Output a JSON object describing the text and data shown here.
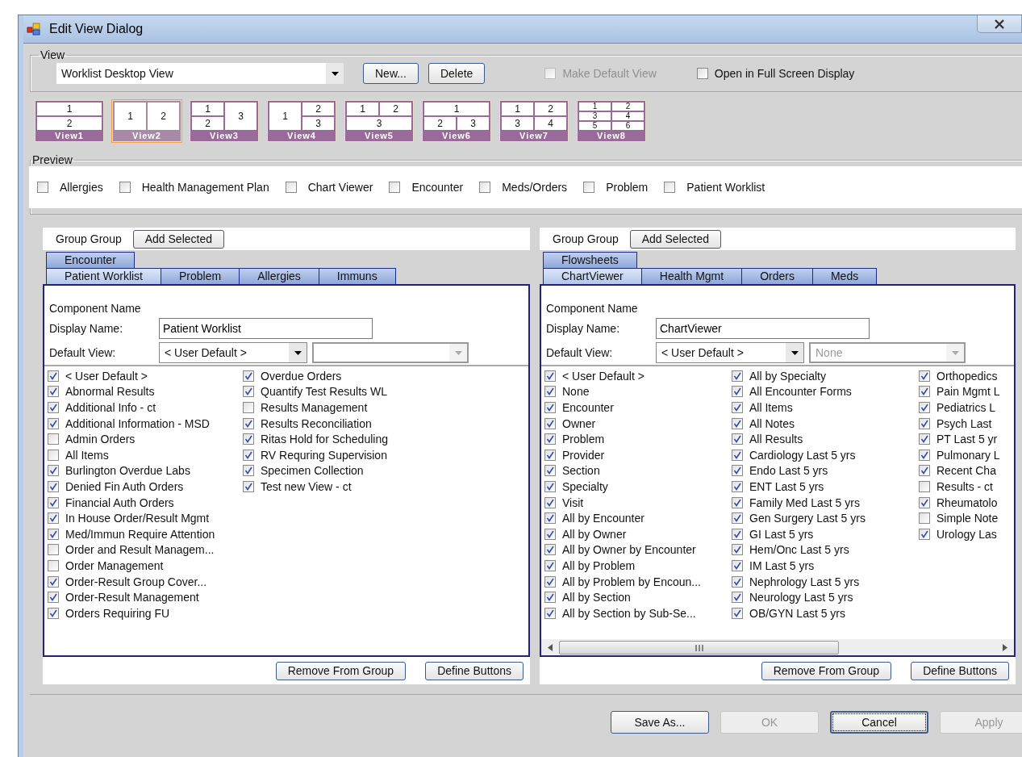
{
  "window": {
    "title": "Edit View Dialog"
  },
  "view_group": {
    "label": "View",
    "dropdown": {
      "value": "Worklist Desktop View"
    },
    "buttons": [
      "New...",
      "Delete"
    ],
    "checkboxes": [
      {
        "label": "Make Default View",
        "checked": false,
        "disabled": true
      },
      {
        "label": "Open in Full Screen Display",
        "checked": false,
        "disabled": false
      }
    ]
  },
  "layouts": [
    {
      "label": "View1",
      "kind": "stack2",
      "cells": [
        "1",
        "2"
      ],
      "selected": false
    },
    {
      "label": "View2",
      "kind": "side2",
      "cells": [
        "1",
        "2"
      ],
      "selected": true
    },
    {
      "label": "View3",
      "kind": "left-split",
      "cells": [
        "1",
        "2",
        "3"
      ],
      "selected": false
    },
    {
      "label": "View4",
      "kind": "right-split",
      "cells": [
        "1",
        "2",
        "3"
      ],
      "selected": false
    },
    {
      "label": "View5",
      "kind": "top-split",
      "cells": [
        "1",
        "2",
        "3"
      ],
      "selected": false
    },
    {
      "label": "View6",
      "kind": "bottom-split",
      "cells": [
        "1",
        "2",
        "3"
      ],
      "selected": false
    },
    {
      "label": "View7",
      "kind": "grid4",
      "cells": [
        "1",
        "2",
        "3",
        "4"
      ],
      "selected": false
    },
    {
      "label": "View8",
      "kind": "grid6",
      "cells": [
        "1",
        "2",
        "3",
        "4",
        "5",
        "6"
      ],
      "selected": false
    }
  ],
  "preview": {
    "label": "Preview",
    "items": [
      {
        "label": "Allergies",
        "checked": false
      },
      {
        "label": "Health Management Plan",
        "checked": false
      },
      {
        "label": "Chart Viewer",
        "checked": false
      },
      {
        "label": "Encounter",
        "checked": false
      },
      {
        "label": "Meds/Orders",
        "checked": false
      },
      {
        "label": "Problem",
        "checked": false
      },
      {
        "label": "Patient Worklist",
        "checked": false
      }
    ]
  },
  "panels": [
    {
      "group_label": "Group Group",
      "add_button": "Add Selected",
      "tab_rows": [
        [
          {
            "label": "Encounter",
            "selected": false
          }
        ],
        [
          {
            "label": "Patient Worklist",
            "selected": true
          },
          {
            "label": "Problem",
            "selected": false
          },
          {
            "label": "Allergies",
            "selected": false
          },
          {
            "label": "Immuns",
            "selected": false
          }
        ]
      ],
      "component_label": "Component Name",
      "display_label": "Display Name:",
      "display_value": "Patient Worklist",
      "default_label": "Default View:",
      "default_value": "< User Default >",
      "secondary": {
        "disabled": true
      },
      "columns": [
        [
          {
            "label": "< User Default >",
            "checked": true
          },
          {
            "label": "Abnormal Results",
            "checked": true
          },
          {
            "label": "Additional Info - ct",
            "checked": true
          },
          {
            "label": "Additional Information - MSD",
            "checked": true
          },
          {
            "label": "Admin Orders",
            "checked": false
          },
          {
            "label": "All Items",
            "checked": false
          },
          {
            "label": "Burlington Overdue Labs",
            "checked": true
          },
          {
            "label": "Denied Fin Auth Orders",
            "checked": true
          },
          {
            "label": "Financial Auth Orders",
            "checked": true
          },
          {
            "label": "In House Order/Result Mgmt",
            "checked": true
          },
          {
            "label": "Med/Immun Require Attention",
            "checked": true
          },
          {
            "label": "Order and Result Managem...",
            "checked": false
          },
          {
            "label": "Order Management",
            "checked": false
          },
          {
            "label": "Order-Result Group Cover...",
            "checked": true
          },
          {
            "label": "Order-Result Management",
            "checked": true
          },
          {
            "label": "Orders Requiring FU",
            "checked": true
          }
        ],
        [
          {
            "label": "Overdue Orders",
            "checked": true
          },
          {
            "label": "Quantify Test Results WL",
            "checked": true
          },
          {
            "label": "Results Management",
            "checked": false
          },
          {
            "label": "Results Reconciliation",
            "checked": true
          },
          {
            "label": "Ritas Hold for Scheduling",
            "checked": true
          },
          {
            "label": "RV Requring Supervision",
            "checked": true
          },
          {
            "label": "Specimen Collection",
            "checked": true
          },
          {
            "label": "Test new View - ct",
            "checked": true
          }
        ]
      ],
      "buttons": [
        "Remove From Group",
        "Define Buttons"
      ]
    },
    {
      "group_label": "Group Group",
      "add_button": "Add Selected",
      "tab_rows": [
        [
          {
            "label": "Flowsheets",
            "selected": false
          }
        ],
        [
          {
            "label": "ChartViewer",
            "selected": true
          },
          {
            "label": "Health Mgmt",
            "selected": false
          },
          {
            "label": "Orders",
            "selected": false
          },
          {
            "label": "Meds",
            "selected": false
          }
        ]
      ],
      "component_label": "Component Name",
      "display_label": "Display Name:",
      "display_value": "ChartViewer",
      "default_label": "Default View:",
      "default_value": "< User Default >",
      "secondary": {
        "value": "None",
        "disabled": true
      },
      "columns": [
        [
          {
            "label": "< User Default >",
            "checked": true
          },
          {
            "label": "None",
            "checked": true
          },
          {
            "label": "Encounter",
            "checked": true
          },
          {
            "label": "Owner",
            "checked": true
          },
          {
            "label": "Problem",
            "checked": true
          },
          {
            "label": "Provider",
            "checked": true
          },
          {
            "label": "Section",
            "checked": true
          },
          {
            "label": "Specialty",
            "checked": true
          },
          {
            "label": "Visit",
            "checked": true
          },
          {
            "label": "All by Encounter",
            "checked": true
          },
          {
            "label": "All by Owner",
            "checked": true
          },
          {
            "label": "All by Owner by Encounter",
            "checked": true
          },
          {
            "label": "All by Problem",
            "checked": true
          },
          {
            "label": "All by Problem by Encoun...",
            "checked": true
          },
          {
            "label": "All by Section",
            "checked": true
          },
          {
            "label": "All by Section by Sub-Se...",
            "checked": true
          }
        ],
        [
          {
            "label": "All by Specialty",
            "checked": true
          },
          {
            "label": "All Encounter Forms",
            "checked": true
          },
          {
            "label": "All Items",
            "checked": true
          },
          {
            "label": "All Notes",
            "checked": true
          },
          {
            "label": "All Results",
            "checked": true
          },
          {
            "label": "Cardiology Last 5 yrs",
            "checked": true
          },
          {
            "label": "Endo Last 5 yrs",
            "checked": true
          },
          {
            "label": "ENT Last 5 yrs",
            "checked": true
          },
          {
            "label": "Family Med Last 5 yrs",
            "checked": true
          },
          {
            "label": "Gen Surgery Last 5 yrs",
            "checked": true
          },
          {
            "label": "GI Last 5 yrs",
            "checked": true
          },
          {
            "label": "Hem/Onc Last 5 yrs",
            "checked": true
          },
          {
            "label": "IM Last 5 yrs",
            "checked": true
          },
          {
            "label": "Nephrology Last 5 yrs",
            "checked": true
          },
          {
            "label": "Neurology Last 5 yrs",
            "checked": true
          },
          {
            "label": "OB/GYN Last 5 yrs",
            "checked": true
          }
        ],
        [
          {
            "label": "Orthopedics",
            "checked": true
          },
          {
            "label": "Pain Mgmt L",
            "checked": true
          },
          {
            "label": "Pediatrics L",
            "checked": true
          },
          {
            "label": "Psych Last",
            "checked": true
          },
          {
            "label": "PT Last 5 yr",
            "checked": true
          },
          {
            "label": "Pulmonary L",
            "checked": true
          },
          {
            "label": "Recent Cha",
            "checked": true
          },
          {
            "label": "Results - ct",
            "checked": false
          },
          {
            "label": "Rheumatolo",
            "checked": true
          },
          {
            "label": "Simple Note",
            "checked": false
          },
          {
            "label": "Urology Las",
            "checked": true
          }
        ]
      ],
      "horizontal_scrollbar": true,
      "buttons": [
        "Remove From Group",
        "Define Buttons"
      ]
    }
  ],
  "footer_buttons": [
    {
      "label": "Save As...",
      "disabled": false,
      "focused": false
    },
    {
      "label": "OK",
      "disabled": true,
      "focused": false
    },
    {
      "label": "Cancel",
      "disabled": false,
      "focused": true
    },
    {
      "label": "Apply",
      "disabled": true,
      "focused": false
    }
  ]
}
